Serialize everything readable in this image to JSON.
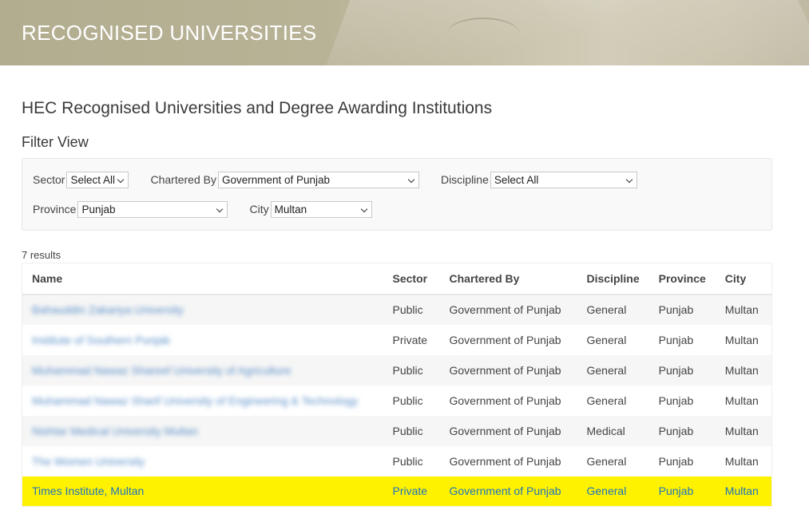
{
  "banner": {
    "title": "RECOGNISED UNIVERSITIES"
  },
  "page": {
    "title": "HEC Recognised Universities and Degree Awarding Institutions"
  },
  "filter": {
    "heading": "Filter View",
    "sector": {
      "label": "Sector",
      "value": "Select All"
    },
    "chartered_by": {
      "label": "Chartered By",
      "value": "Government of Punjab"
    },
    "discipline": {
      "label": "Discipline",
      "value": "Select All"
    },
    "province": {
      "label": "Province",
      "value": "Punjab"
    },
    "city": {
      "label": "City",
      "value": "Multan"
    }
  },
  "results": {
    "count": "7 results"
  },
  "table": {
    "headers": {
      "name": "Name",
      "sector": "Sector",
      "chartered_by": "Chartered By",
      "discipline": "Discipline",
      "province": "Province",
      "city": "City"
    },
    "rows": [
      {
        "name": "Bahauddin Zakariya University",
        "sector": "Public",
        "chartered_by": "Government of Punjab",
        "discipline": "General",
        "province": "Punjab",
        "city": "Multan",
        "blurred": true,
        "highlight": false
      },
      {
        "name": "Institute of Southern Punjab",
        "sector": "Private",
        "chartered_by": "Government of Punjab",
        "discipline": "General",
        "province": "Punjab",
        "city": "Multan",
        "blurred": true,
        "highlight": false
      },
      {
        "name": "Muhammad Nawaz Shareef University of Agriculture",
        "sector": "Public",
        "chartered_by": "Government of Punjab",
        "discipline": "General",
        "province": "Punjab",
        "city": "Multan",
        "blurred": true,
        "highlight": false
      },
      {
        "name": "Muhammad Nawaz Sharif University of Engineering & Technology",
        "sector": "Public",
        "chartered_by": "Government of Punjab",
        "discipline": "General",
        "province": "Punjab",
        "city": "Multan",
        "blurred": true,
        "highlight": false
      },
      {
        "name": "Nishtar Medical University Multan",
        "sector": "Public",
        "chartered_by": "Government of Punjab",
        "discipline": "Medical",
        "province": "Punjab",
        "city": "Multan",
        "blurred": true,
        "highlight": false
      },
      {
        "name": "The Women University",
        "sector": "Public",
        "chartered_by": "Government of Punjab",
        "discipline": "General",
        "province": "Punjab",
        "city": "Multan",
        "blurred": true,
        "highlight": false
      },
      {
        "name": "Times Institute, Multan",
        "sector": "Private",
        "chartered_by": "Government of Punjab",
        "discipline": "General",
        "province": "Punjab",
        "city": "Multan",
        "blurred": false,
        "highlight": true
      }
    ]
  }
}
